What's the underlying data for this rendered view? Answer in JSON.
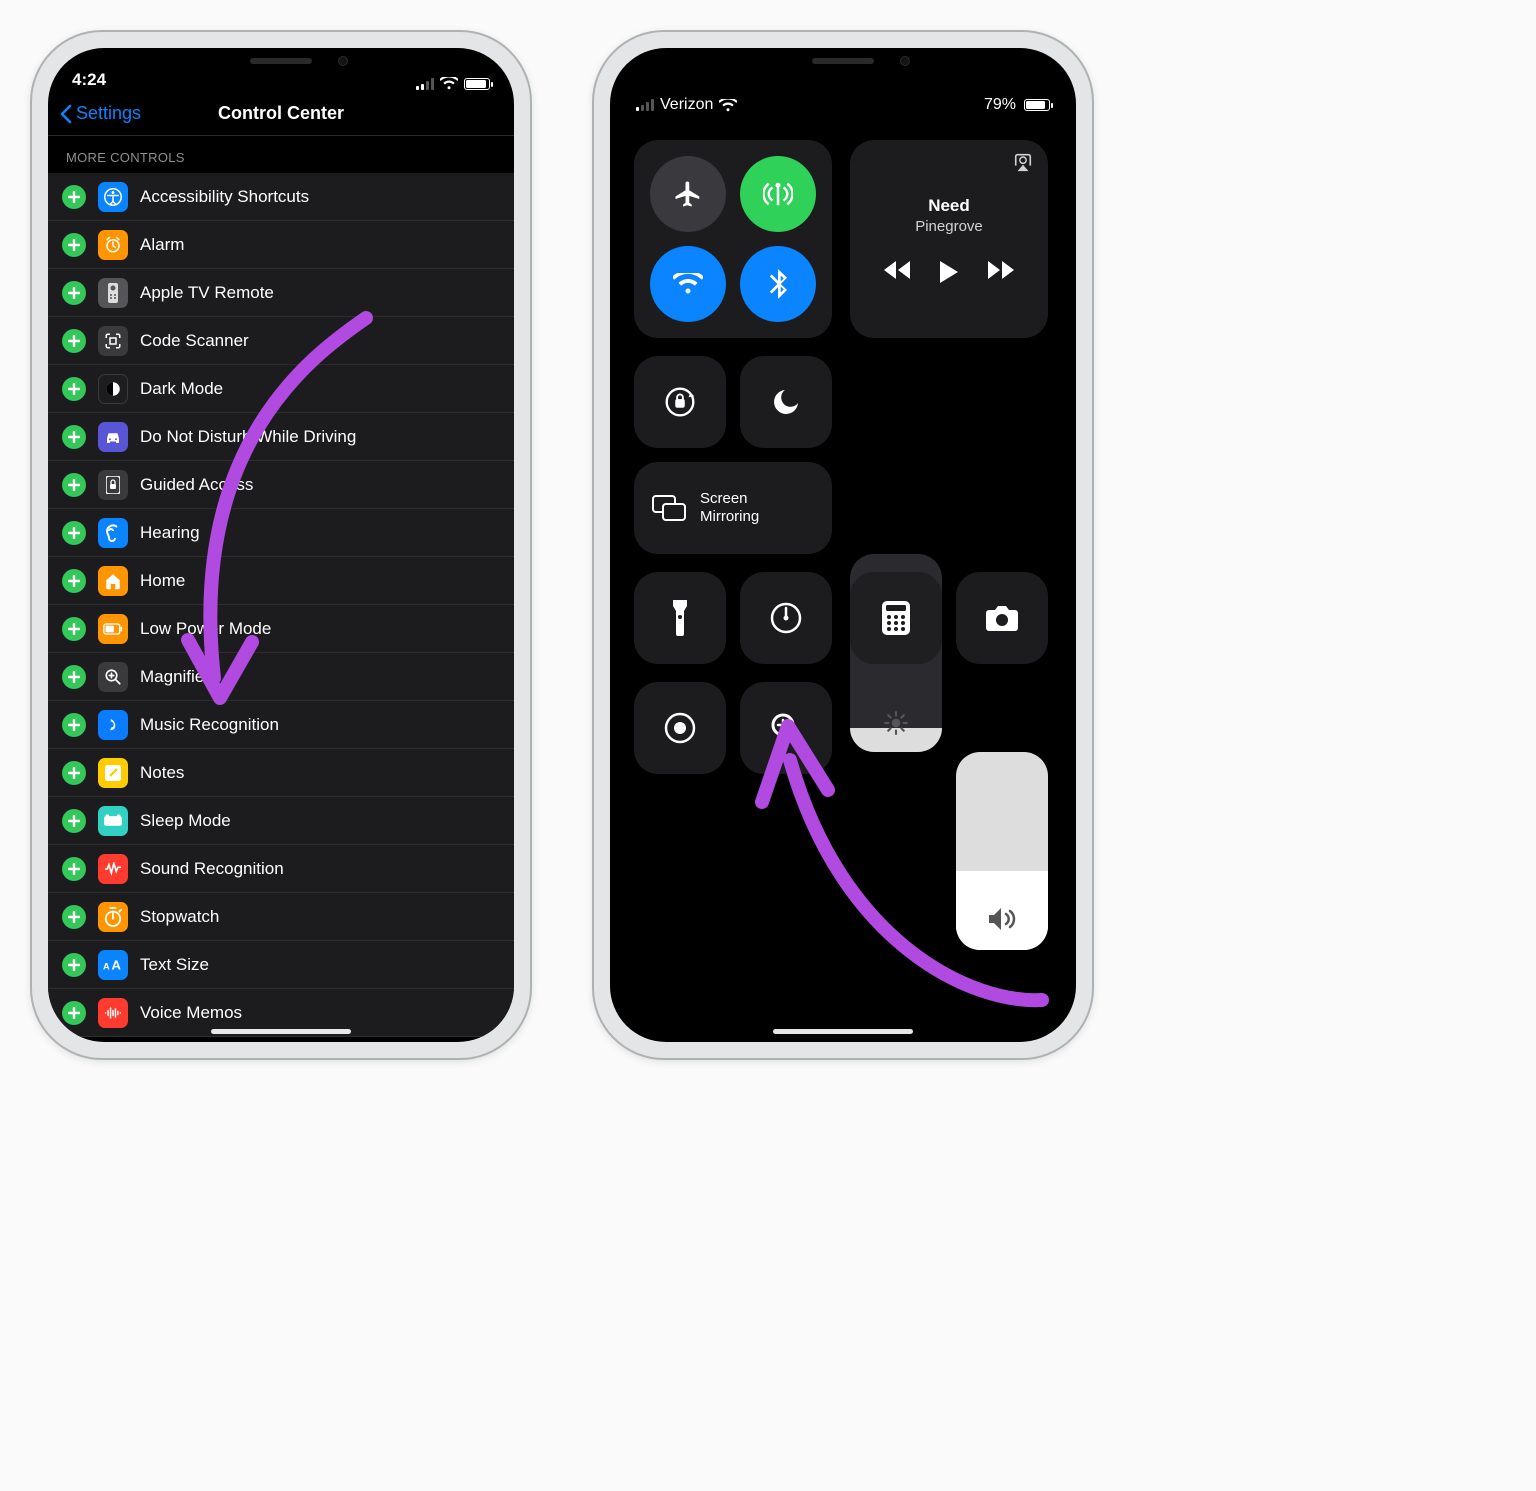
{
  "left": {
    "status": {
      "time": "4:24"
    },
    "nav": {
      "back": "Settings",
      "title": "Control Center"
    },
    "section_header": "MORE CONTROLS",
    "rows": [
      {
        "icon": "accessibility-icon",
        "bg": "bg-blue",
        "label": "Accessibility Shortcuts"
      },
      {
        "icon": "alarm-icon",
        "bg": "bg-orange",
        "label": "Alarm"
      },
      {
        "icon": "appletv-remote-icon",
        "bg": "bg-gray",
        "label": "Apple TV Remote"
      },
      {
        "icon": "qr-scanner-icon",
        "bg": "bg-darkgy",
        "label": "Code Scanner"
      },
      {
        "icon": "dark-mode-icon",
        "bg": "bg-black",
        "label": "Dark Mode"
      },
      {
        "icon": "car-dnd-icon",
        "bg": "bg-purple",
        "label": "Do Not Disturb While Driving"
      },
      {
        "icon": "guided-access-icon",
        "bg": "bg-darkgy",
        "label": "Guided Access"
      },
      {
        "icon": "hearing-icon",
        "bg": "bg-blue",
        "label": "Hearing"
      },
      {
        "icon": "home-icon",
        "bg": "bg-orange",
        "label": "Home"
      },
      {
        "icon": "low-power-icon",
        "bg": "bg-orange",
        "label": "Low Power Mode"
      },
      {
        "icon": "magnifier-icon",
        "bg": "bg-darkgy",
        "label": "Magnifier"
      },
      {
        "icon": "music-recog-icon",
        "bg": "bg-shazam",
        "label": "Music Recognition"
      },
      {
        "icon": "notes-icon",
        "bg": "bg-yellow",
        "label": "Notes"
      },
      {
        "icon": "sleep-mode-icon",
        "bg": "bg-teal",
        "label": "Sleep Mode"
      },
      {
        "icon": "sound-recog-icon",
        "bg": "bg-red",
        "label": "Sound Recognition"
      },
      {
        "icon": "stopwatch-icon",
        "bg": "bg-orange",
        "label": "Stopwatch"
      },
      {
        "icon": "text-size-icon",
        "bg": "bg-blue",
        "label": "Text Size"
      },
      {
        "icon": "voice-memos-icon",
        "bg": "bg-red",
        "label": "Voice Memos"
      }
    ]
  },
  "right": {
    "status": {
      "carrier": "Verizon",
      "battery": "79%"
    },
    "media": {
      "title": "Need",
      "artist": "Pinegrove"
    },
    "mirror": "Screen\nMirroring"
  }
}
